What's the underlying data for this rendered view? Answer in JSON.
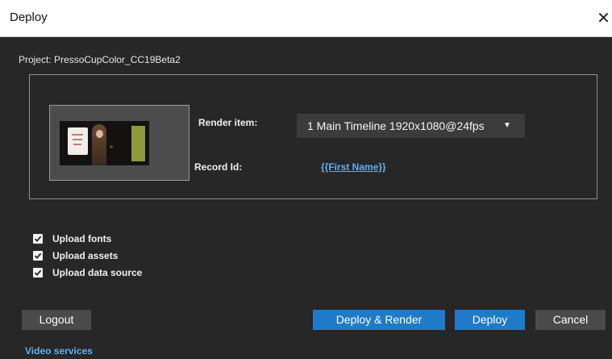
{
  "window": {
    "title": "Deploy",
    "close_glyph": "✕"
  },
  "project": {
    "label": "Project: PressoCupColor_CC19Beta2"
  },
  "render": {
    "label": "Render item:",
    "selected": "1 Main Timeline 1920x1080@24fps",
    "caret_icon": "chevron-down-icon"
  },
  "record": {
    "label": "Record Id:",
    "value": "{{First Name}}"
  },
  "options": {
    "items": [
      {
        "label": "Upload fonts",
        "checked": true
      },
      {
        "label": "Upload assets",
        "checked": true
      },
      {
        "label": "Upload data source",
        "checked": true
      }
    ]
  },
  "buttons": {
    "logout": "Logout",
    "deploy_render": "Deploy & Render",
    "deploy": "Deploy",
    "cancel": "Cancel"
  },
  "footer": {
    "video_services": "Video services"
  },
  "colors": {
    "background": "#272727",
    "accent_blue": "#1f7bc7",
    "link_blue": "#5bb0f5",
    "button_gray": "#4a4a4a"
  }
}
